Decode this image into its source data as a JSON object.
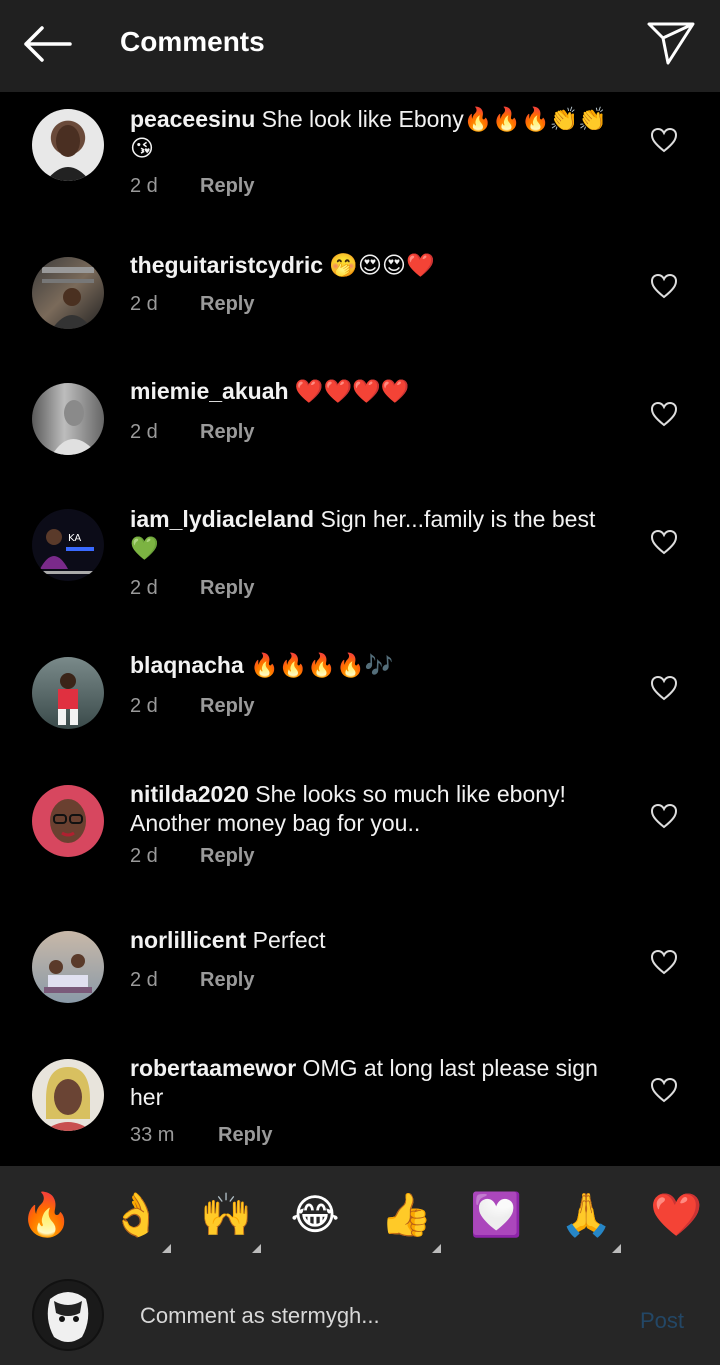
{
  "header": {
    "title": "Comments"
  },
  "comments": [
    {
      "user": "peaceesinu",
      "text": " She look like Ebony🔥🔥🔥👏👏 😘",
      "time": "2 d",
      "reply": "Reply"
    },
    {
      "user": "theguitaristcydric",
      "text": " 🤭😍😍❤️",
      "time": "2 d",
      "reply": "Reply"
    },
    {
      "user": "miemie_akuah",
      "text": " ❤️❤️❤️❤️",
      "time": "2 d",
      "reply": "Reply"
    },
    {
      "user": "iam_lydiacleland",
      "text": " Sign her...family is the best 💚",
      "time": "2 d",
      "reply": "Reply"
    },
    {
      "user": "blaqnacha",
      "text": " 🔥🔥🔥🔥🎶",
      "time": "2 d",
      "reply": "Reply"
    },
    {
      "user": "nitilda2020",
      "text": " She looks so much like ebony! Another money bag for you..",
      "time": "2 d",
      "reply": "Reply"
    },
    {
      "user": "norlillicent",
      "text": " Perfect",
      "time": "2 d",
      "reply": "Reply"
    },
    {
      "user": "robertaamewor",
      "text": " OMG at long last please sign her",
      "time": "33 m",
      "reply": "Reply"
    }
  ],
  "emoji_bar": [
    "🔥",
    "👌",
    "🙌",
    "😂",
    "👍",
    "💟",
    "🙏",
    "❤️"
  ],
  "composer": {
    "placeholder": "Comment as stermygh...",
    "post_label": "Post"
  },
  "colors": {
    "background": "#000000",
    "header": "#202020",
    "bar": "#262626",
    "post_disabled": "#234766",
    "meta": "#9a9a9a"
  }
}
